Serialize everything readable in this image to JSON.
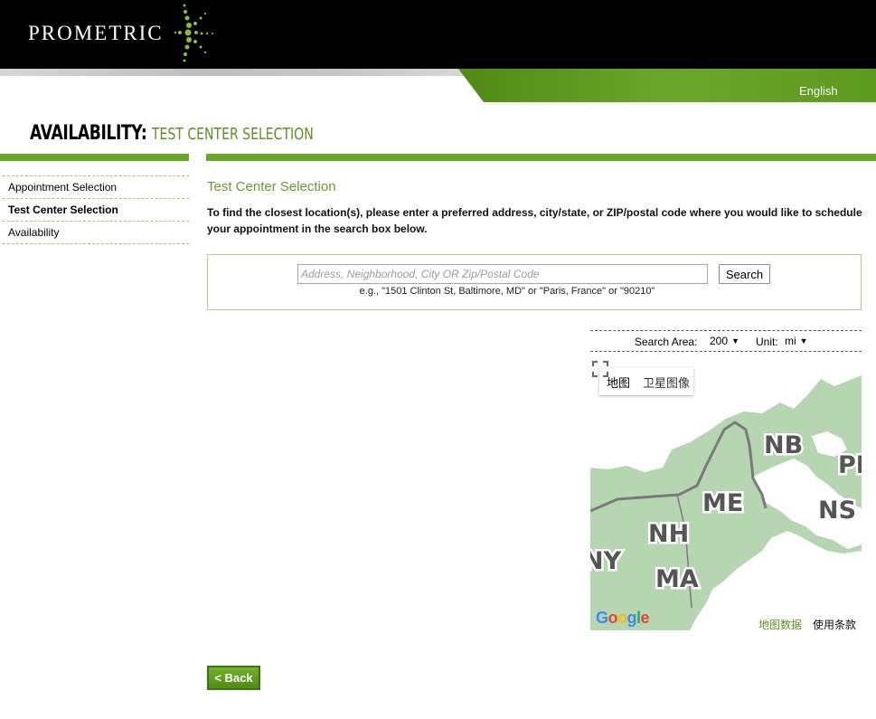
{
  "brand": {
    "logo_text": "PROMETRIC"
  },
  "header": {
    "language": "English"
  },
  "page": {
    "title": "AVAILABILITY:",
    "subtitle": "TEST CENTER SELECTION"
  },
  "sidebar": {
    "items": [
      {
        "label": "Appointment Selection",
        "current": false
      },
      {
        "label": "Test Center Selection",
        "current": true
      },
      {
        "label": "Availability",
        "current": false
      }
    ]
  },
  "main": {
    "section_title": "Test Center Selection",
    "instructions": "To find the closest location(s), please enter a preferred address, city/state, or ZIP/postal code where you would like to schedule your appointment in the search box below.",
    "search": {
      "value": "",
      "placeholder": "Address, Neighborhood, City OR Zip/Postal Code",
      "button_label": "Search",
      "example": "e.g., \"1501 Clinton St, Baltimore, MD\" or \"Paris, France\" or \"90210\""
    },
    "search_area": {
      "label": "Search Area:",
      "value": "200",
      "unit_label": "Unit:",
      "unit_value": "mi"
    }
  },
  "map": {
    "tabs": [
      "地图",
      "卫星图像"
    ],
    "region_labels": [
      "NB",
      "PE",
      "ME",
      "NS",
      "NH",
      "NY",
      "MA"
    ],
    "google_logo": "Google",
    "data_link": "地图数据",
    "terms_link": "使用条款",
    "colors": {
      "land": "#b5d6b0",
      "water": "#ffffff",
      "border": "#7a7a7a"
    }
  },
  "footer": {
    "back_label": "< Back"
  },
  "colors": {
    "accent": "#6aa62a",
    "title_green": "#5f8f24",
    "header_bg": "#000000"
  }
}
